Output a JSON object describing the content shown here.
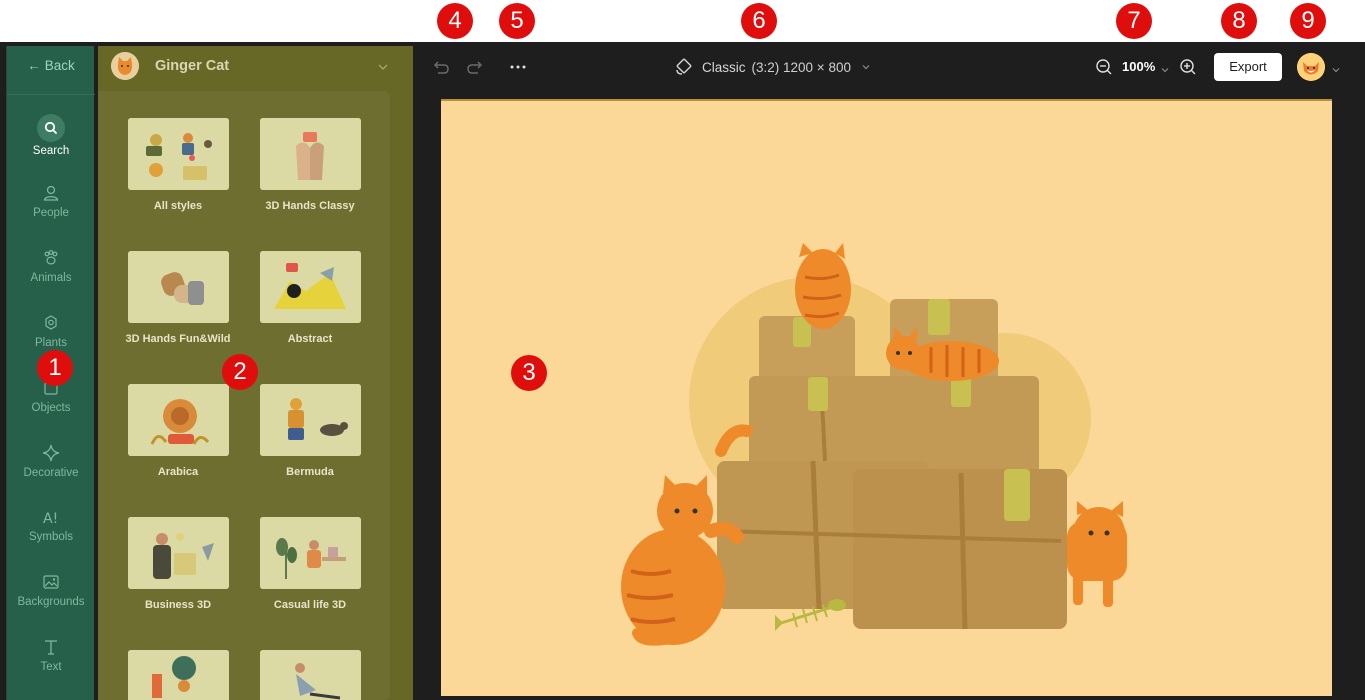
{
  "nav": {
    "back_label": "Back",
    "items": [
      {
        "label": "Search",
        "icon": "search-icon",
        "active": true
      },
      {
        "label": "People",
        "icon": "person-icon"
      },
      {
        "label": "Animals",
        "icon": "paw-icon"
      },
      {
        "label": "Plants",
        "icon": "flower-icon"
      },
      {
        "label": "Objects",
        "icon": "cube-icon"
      },
      {
        "label": "Decorative",
        "icon": "sparkle-icon"
      },
      {
        "label": "Symbols",
        "icon": "symbols-icon"
      },
      {
        "label": "Backgrounds",
        "icon": "image-icon"
      },
      {
        "label": "Text",
        "icon": "text-icon"
      }
    ]
  },
  "panel": {
    "title": "Ginger Cat",
    "styles": [
      {
        "label": "All styles"
      },
      {
        "label": "3D Hands Classy"
      },
      {
        "label": "3D Hands Fun&Wild"
      },
      {
        "label": "Abstract"
      },
      {
        "label": "Arabica"
      },
      {
        "label": "Bermuda"
      },
      {
        "label": "Business 3D"
      },
      {
        "label": "Casual life 3D"
      },
      {
        "label": ""
      },
      {
        "label": ""
      }
    ]
  },
  "toolbar": {
    "preset_name": "Classic",
    "preset_dims": "(3:2) 1200 × 800",
    "zoom": "100%",
    "export_label": "Export"
  },
  "markers": [
    "1",
    "2",
    "3",
    "4",
    "5",
    "6",
    "7",
    "8",
    "9"
  ],
  "colors": {
    "nav_bg": "#27604a",
    "panel_bg": "#676726",
    "canvas_bg": "#fbd897",
    "app_bg": "#1e1e1e",
    "marker": "#e00d0d"
  }
}
